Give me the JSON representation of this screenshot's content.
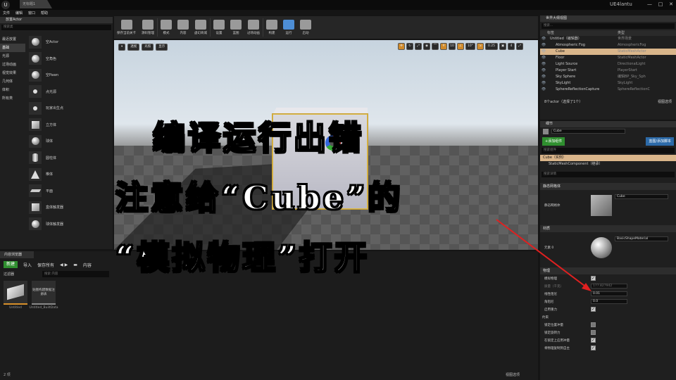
{
  "window": {
    "tab": "无标题1",
    "user": "UE4lantu",
    "min": "—",
    "max": "□",
    "close": "✕",
    "logo": "U"
  },
  "menu": [
    "文件",
    "编辑",
    "窗口",
    "帮助"
  ],
  "place": {
    "tab": "放置Actor",
    "search": "搜索类",
    "categories": [
      "最近放置",
      "基础",
      "光源",
      "过场动画",
      "视觉效果",
      "几何体",
      "体积",
      "所有类"
    ],
    "items": [
      {
        "label": "空Actor",
        "icon": "sphere"
      },
      {
        "label": "空角色",
        "icon": "sphere"
      },
      {
        "label": "空Pawn",
        "icon": "sphere"
      },
      {
        "label": "点光源",
        "icon": "dot"
      },
      {
        "label": "玩家出生点",
        "icon": "dot"
      },
      {
        "label": "立方体",
        "icon": "box"
      },
      {
        "label": "球体",
        "icon": "sphere"
      },
      {
        "label": "圆柱体",
        "icon": "cylinder"
      },
      {
        "label": "椎体",
        "icon": "cone"
      },
      {
        "label": "平面",
        "icon": "plane"
      },
      {
        "label": "盒体触发器",
        "icon": "box"
      },
      {
        "label": "球体触发器",
        "icon": "sphere"
      }
    ]
  },
  "toolbar": [
    {
      "label": "保存当前关卡"
    },
    {
      "label": "源码管理"
    },
    {
      "label": "模式"
    },
    {
      "label": "内容"
    },
    {
      "label": "虚幻商城"
    },
    {
      "label": "设置"
    },
    {
      "label": "蓝图"
    },
    {
      "label": "过场动画"
    },
    {
      "label": "构建"
    },
    {
      "label": "运行",
      "accent": true
    },
    {
      "label": "启动"
    }
  ],
  "viewport": {
    "left": [
      "▾",
      "透视",
      "光照",
      "显示"
    ],
    "right": {
      "grid": "10",
      "angle": "10°",
      "scale": "0.25",
      "cam": "4"
    }
  },
  "overlay": {
    "line1": "编译运行出错",
    "line2": "注意给“Cube”的",
    "line3": "“模拟物理”打开"
  },
  "content": {
    "tab": "内容浏览器",
    "new": "新建",
    "import": "导入",
    "save_all": "保存所有",
    "path": "内容",
    "filter": "过滤器",
    "search": "搜索 内容",
    "assets": [
      {
        "thumb": "贴图构建数据注册表",
        "name": "Untitled"
      },
      {
        "thumb": "贴图构建数据注册表",
        "name": "Untitled_BuiltData"
      }
    ],
    "status": "2 项",
    "view": "视图选项"
  },
  "outliner": {
    "tab": "世界大纲视图",
    "search": "搜索...",
    "col_label": "标签",
    "col_type": "类型",
    "rows": [
      {
        "label": "Untitled（编辑器）",
        "type": "世界场景",
        "indent": 0
      },
      {
        "label": "Atmospheric Fog",
        "type": "AtmosphericFog",
        "indent": 1
      },
      {
        "label": "Cube",
        "type": "StaticMeshActor",
        "indent": 1,
        "selected": true
      },
      {
        "label": "Floor",
        "type": "StaticMeshActor",
        "indent": 1
      },
      {
        "label": "Light Source",
        "type": "DirectionalLight",
        "indent": 1
      },
      {
        "label": "Player Start",
        "type": "PlayerStart",
        "indent": 1
      },
      {
        "label": "Sky Sphere",
        "type": "编辑BP_Sky_Sph",
        "indent": 1
      },
      {
        "label": "SkyLight",
        "type": "SkyLight",
        "indent": 1
      },
      {
        "label": "SphereReflectionCapture",
        "type": "SphereReflectionC",
        "indent": 1
      }
    ],
    "footer": "8个actor（选择了1个）",
    "view": "视图选项"
  },
  "details": {
    "tab": "细节",
    "name": "Cube",
    "add_component": "+添加组件",
    "blueprint": "蓝图/添加脚本",
    "search_components": "搜索组件",
    "instance": "Cube（实例）",
    "component": "StaticMeshComponent（继承）",
    "search_details": "搜索详情",
    "sec_mesh": "静态网格体",
    "mesh_label": "静态网格体",
    "mesh_value": "Cube",
    "sec_material": "材质",
    "mat_label": "元素 0",
    "mat_value": "BasicShapeMaterial",
    "mat_sub": "纹理",
    "sec_physics": "物理",
    "simulate": "模拟物理",
    "mass_label": "质量（千克）",
    "mass": "177.827942",
    "lin_damp_label": "线性阻尼",
    "lin_damp": "0.01",
    "ang_damp_label": "角阻尼",
    "ang_damp": "0.0",
    "gravity": "启用重力",
    "constraints": "约束",
    "lock_pos": "锁定位置冲量",
    "lock_rot": "锁定旋转力",
    "lock_axis": "在锁定上应用冲量",
    "replicate": "将物理复制到自主"
  },
  "colors": {
    "accent_green": "#2f8f2f",
    "accent_blue": "#2c6aa8",
    "selection": "#d9b58a",
    "arrow": "#e02020"
  }
}
